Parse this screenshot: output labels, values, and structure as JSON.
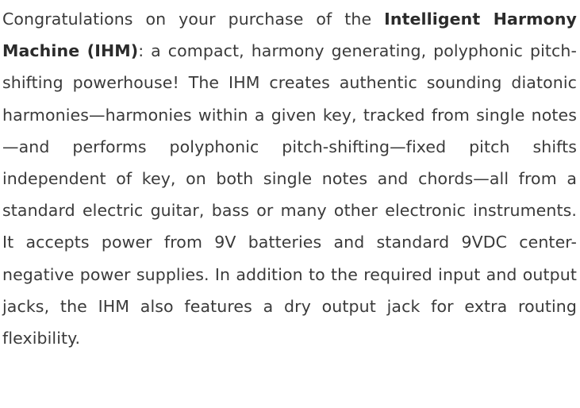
{
  "document": {
    "intro_before_name": "Congratulations on your purchase of the ",
    "product_name": "Intelligent Harmony Machine (IHM)",
    "body_text": ": a compact, harmony generating, polyphonic pitch-shifting powerhouse! The IHM creates authentic sound­ing diatonic harmonies—harmonies within a given key, tracked from single notes—and performs polyphonic pitch-shifting—fixed pitch shifts independent of key, on both single notes and chords—all from a standard electric guitar, bass or many other electronic instruments. It accepts power from 9V bat­teries and standard 9VDC center-negative power supplies. In addition to the required input and output jacks, the IHM also features a dry output jack for extra routing flexibility."
  }
}
